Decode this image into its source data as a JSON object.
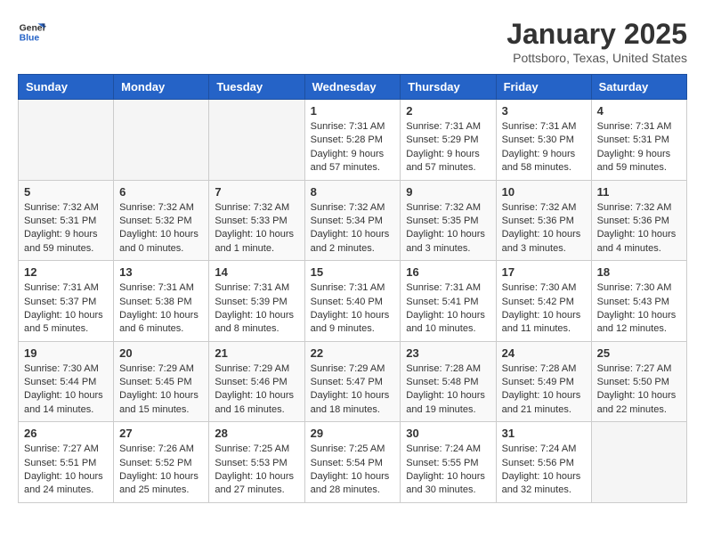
{
  "header": {
    "logo_line1": "General",
    "logo_line2": "Blue",
    "month": "January 2025",
    "location": "Pottsboro, Texas, United States"
  },
  "weekdays": [
    "Sunday",
    "Monday",
    "Tuesday",
    "Wednesday",
    "Thursday",
    "Friday",
    "Saturday"
  ],
  "weeks": [
    [
      {
        "day": "",
        "info": ""
      },
      {
        "day": "",
        "info": ""
      },
      {
        "day": "",
        "info": ""
      },
      {
        "day": "1",
        "info": "Sunrise: 7:31 AM\nSunset: 5:28 PM\nDaylight: 9 hours\nand 57 minutes."
      },
      {
        "day": "2",
        "info": "Sunrise: 7:31 AM\nSunset: 5:29 PM\nDaylight: 9 hours\nand 57 minutes."
      },
      {
        "day": "3",
        "info": "Sunrise: 7:31 AM\nSunset: 5:30 PM\nDaylight: 9 hours\nand 58 minutes."
      },
      {
        "day": "4",
        "info": "Sunrise: 7:31 AM\nSunset: 5:31 PM\nDaylight: 9 hours\nand 59 minutes."
      }
    ],
    [
      {
        "day": "5",
        "info": "Sunrise: 7:32 AM\nSunset: 5:31 PM\nDaylight: 9 hours\nand 59 minutes."
      },
      {
        "day": "6",
        "info": "Sunrise: 7:32 AM\nSunset: 5:32 PM\nDaylight: 10 hours\nand 0 minutes."
      },
      {
        "day": "7",
        "info": "Sunrise: 7:32 AM\nSunset: 5:33 PM\nDaylight: 10 hours\nand 1 minute."
      },
      {
        "day": "8",
        "info": "Sunrise: 7:32 AM\nSunset: 5:34 PM\nDaylight: 10 hours\nand 2 minutes."
      },
      {
        "day": "9",
        "info": "Sunrise: 7:32 AM\nSunset: 5:35 PM\nDaylight: 10 hours\nand 3 minutes."
      },
      {
        "day": "10",
        "info": "Sunrise: 7:32 AM\nSunset: 5:36 PM\nDaylight: 10 hours\nand 3 minutes."
      },
      {
        "day": "11",
        "info": "Sunrise: 7:32 AM\nSunset: 5:36 PM\nDaylight: 10 hours\nand 4 minutes."
      }
    ],
    [
      {
        "day": "12",
        "info": "Sunrise: 7:31 AM\nSunset: 5:37 PM\nDaylight: 10 hours\nand 5 minutes."
      },
      {
        "day": "13",
        "info": "Sunrise: 7:31 AM\nSunset: 5:38 PM\nDaylight: 10 hours\nand 6 minutes."
      },
      {
        "day": "14",
        "info": "Sunrise: 7:31 AM\nSunset: 5:39 PM\nDaylight: 10 hours\nand 8 minutes."
      },
      {
        "day": "15",
        "info": "Sunrise: 7:31 AM\nSunset: 5:40 PM\nDaylight: 10 hours\nand 9 minutes."
      },
      {
        "day": "16",
        "info": "Sunrise: 7:31 AM\nSunset: 5:41 PM\nDaylight: 10 hours\nand 10 minutes."
      },
      {
        "day": "17",
        "info": "Sunrise: 7:30 AM\nSunset: 5:42 PM\nDaylight: 10 hours\nand 11 minutes."
      },
      {
        "day": "18",
        "info": "Sunrise: 7:30 AM\nSunset: 5:43 PM\nDaylight: 10 hours\nand 12 minutes."
      }
    ],
    [
      {
        "day": "19",
        "info": "Sunrise: 7:30 AM\nSunset: 5:44 PM\nDaylight: 10 hours\nand 14 minutes."
      },
      {
        "day": "20",
        "info": "Sunrise: 7:29 AM\nSunset: 5:45 PM\nDaylight: 10 hours\nand 15 minutes."
      },
      {
        "day": "21",
        "info": "Sunrise: 7:29 AM\nSunset: 5:46 PM\nDaylight: 10 hours\nand 16 minutes."
      },
      {
        "day": "22",
        "info": "Sunrise: 7:29 AM\nSunset: 5:47 PM\nDaylight: 10 hours\nand 18 minutes."
      },
      {
        "day": "23",
        "info": "Sunrise: 7:28 AM\nSunset: 5:48 PM\nDaylight: 10 hours\nand 19 minutes."
      },
      {
        "day": "24",
        "info": "Sunrise: 7:28 AM\nSunset: 5:49 PM\nDaylight: 10 hours\nand 21 minutes."
      },
      {
        "day": "25",
        "info": "Sunrise: 7:27 AM\nSunset: 5:50 PM\nDaylight: 10 hours\nand 22 minutes."
      }
    ],
    [
      {
        "day": "26",
        "info": "Sunrise: 7:27 AM\nSunset: 5:51 PM\nDaylight: 10 hours\nand 24 minutes."
      },
      {
        "day": "27",
        "info": "Sunrise: 7:26 AM\nSunset: 5:52 PM\nDaylight: 10 hours\nand 25 minutes."
      },
      {
        "day": "28",
        "info": "Sunrise: 7:25 AM\nSunset: 5:53 PM\nDaylight: 10 hours\nand 27 minutes."
      },
      {
        "day": "29",
        "info": "Sunrise: 7:25 AM\nSunset: 5:54 PM\nDaylight: 10 hours\nand 28 minutes."
      },
      {
        "day": "30",
        "info": "Sunrise: 7:24 AM\nSunset: 5:55 PM\nDaylight: 10 hours\nand 30 minutes."
      },
      {
        "day": "31",
        "info": "Sunrise: 7:24 AM\nSunset: 5:56 PM\nDaylight: 10 hours\nand 32 minutes."
      },
      {
        "day": "",
        "info": ""
      }
    ]
  ]
}
